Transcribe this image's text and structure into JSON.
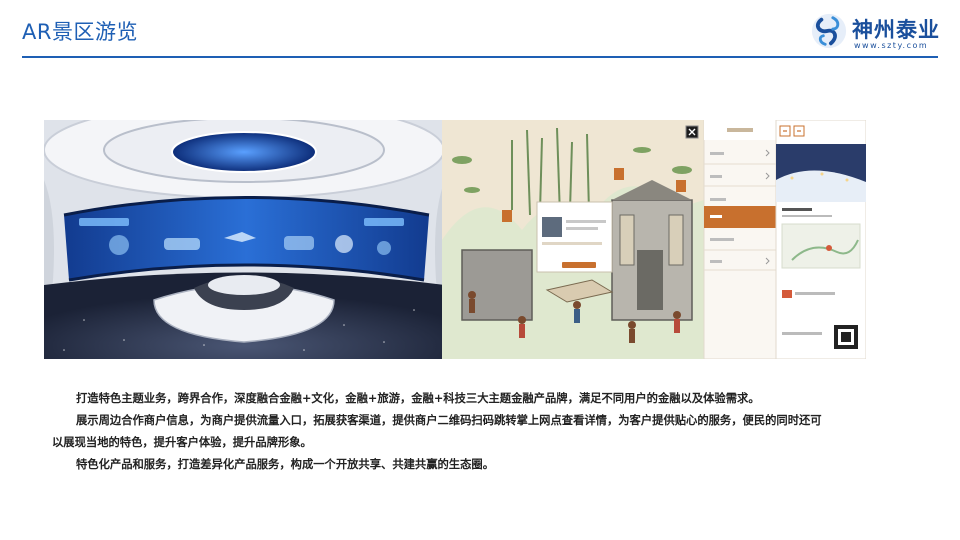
{
  "header": {
    "title": "AR景区游览",
    "logo_name": "神州泰业",
    "logo_url": "www.szty.com"
  },
  "images": {
    "left_caption": "",
    "right_caption": ""
  },
  "body": {
    "paragraphs": [
      "打造特色主题业务，跨界合作，深度融合金融+文化，金融+旅游，金融+科技三大主题金融产品牌，满足不同用户的金融以及体验需求。",
      "展示周边合作商户信息，为商户提供流量入口，拓展获客渠道，提供商户二维码扫码跳转掌上网点查看详情，为客户提供贴心的服务，便民的同时还可以展现当地的特色，提升客户体验，提升品牌形象。",
      "特色化产品和服务，打造差异化产品服务，构成一个开放共享、共建共赢的生态圈。"
    ]
  },
  "colors": {
    "brand_blue": "#1e5fb4",
    "accent_orange": "#c8702e"
  },
  "icons": [
    "logo-mark-icon",
    "close-icon",
    "arrow-left-icon",
    "arrow-right-icon",
    "chevron-right-icon"
  ]
}
